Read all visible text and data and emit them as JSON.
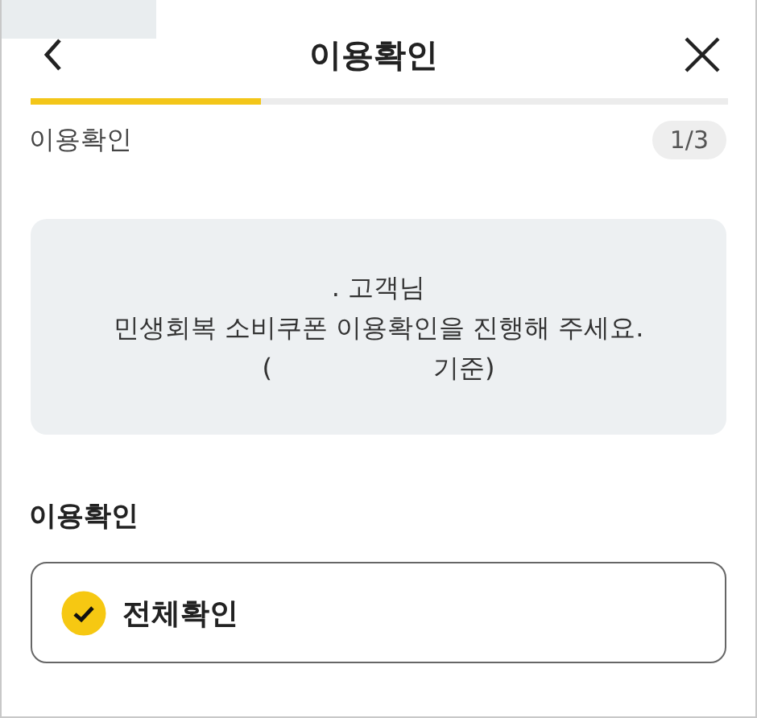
{
  "header": {
    "title": "이용확인"
  },
  "progress": {
    "level": 0.33,
    "label": "이용확인",
    "step": "1/3"
  },
  "notice": {
    "lines": [
      [
        ". 고객님"
      ],
      [
        "민생회복 소비쿠폰 이용확인을 진행해 주세요."
      ],
      [
        "(",
        "기준)"
      ]
    ]
  },
  "section": {
    "title": "이용확인",
    "options": [
      {
        "label": "전체확인",
        "checked": true
      }
    ]
  }
}
